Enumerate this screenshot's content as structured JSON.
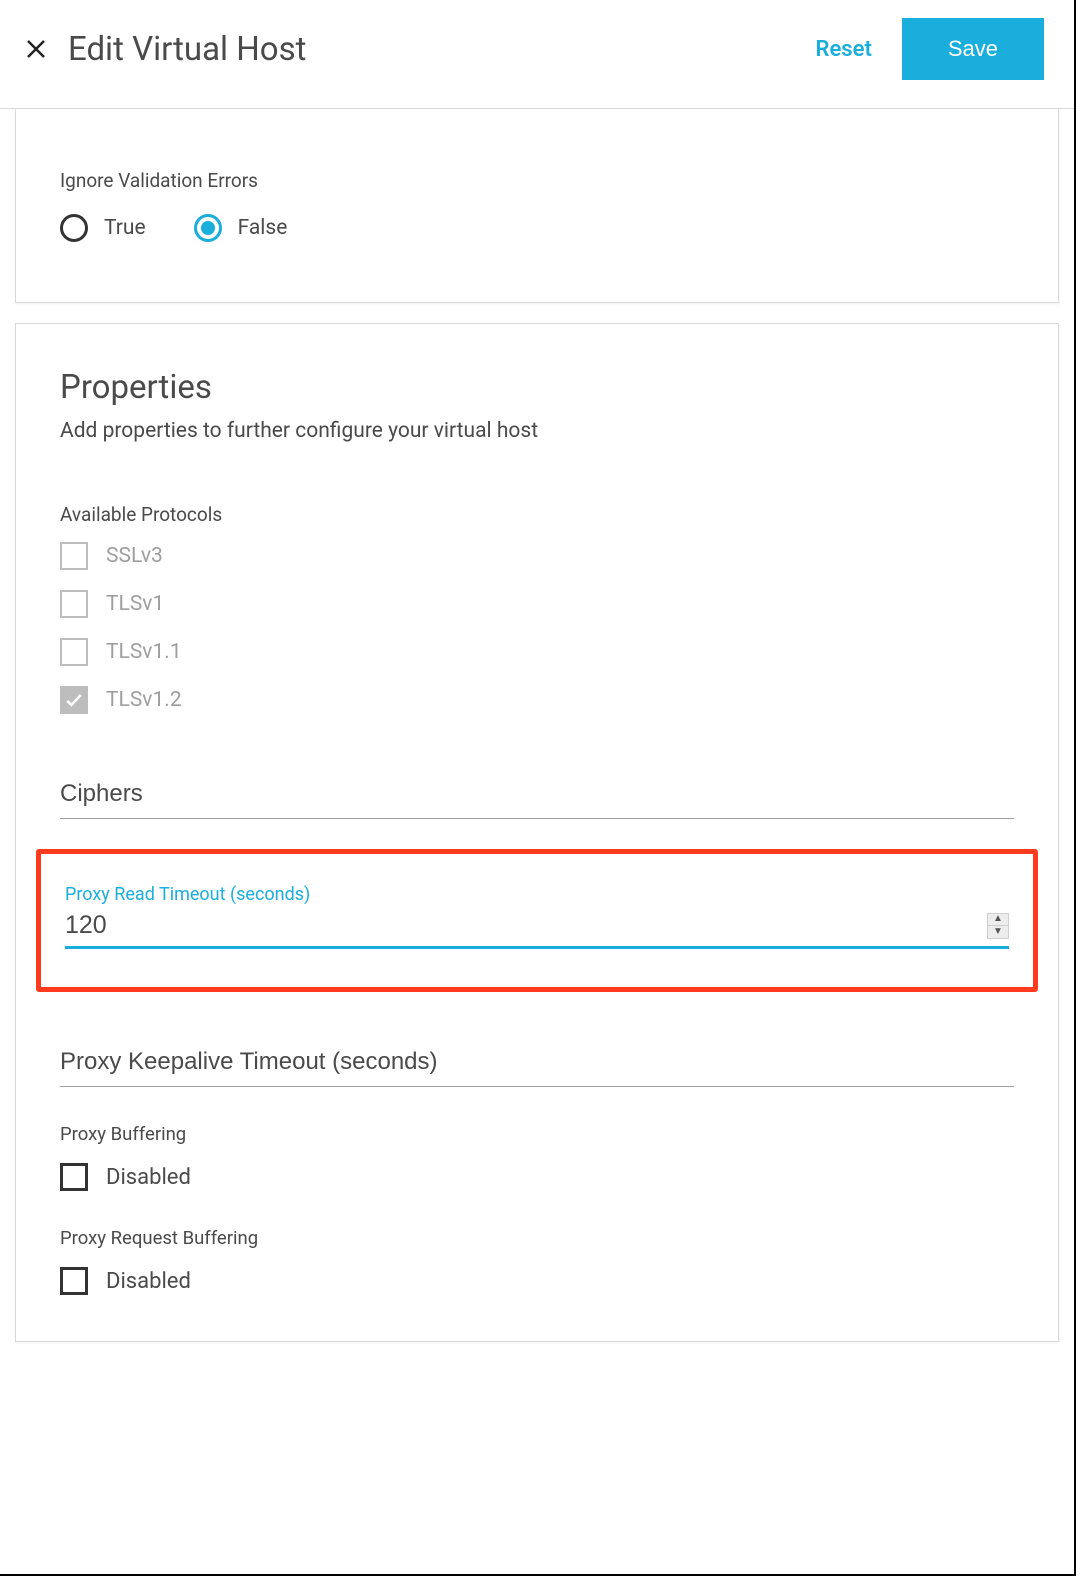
{
  "header": {
    "title": "Edit Virtual Host",
    "reset_label": "Reset",
    "save_label": "Save"
  },
  "validation": {
    "label": "Ignore Validation Errors",
    "options": {
      "true_label": "True",
      "false_label": "False"
    },
    "selected": "false"
  },
  "properties": {
    "heading": "Properties",
    "subheading": "Add properties to further configure your virtual host",
    "protocols_label": "Available Protocols",
    "protocols": [
      {
        "label": "SSLv3",
        "checked": false,
        "disabled": true
      },
      {
        "label": "TLSv1",
        "checked": false,
        "disabled": true
      },
      {
        "label": "TLSv1.1",
        "checked": false,
        "disabled": true
      },
      {
        "label": "TLSv1.2",
        "checked": true,
        "disabled": true
      }
    ],
    "ciphers_label": "Ciphers",
    "proxy_read_timeout": {
      "label": "Proxy Read Timeout (seconds)",
      "value": "120"
    },
    "proxy_keepalive_label": "Proxy Keepalive Timeout (seconds)",
    "proxy_buffering": {
      "label": "Proxy Buffering",
      "option_label": "Disabled",
      "checked": false
    },
    "proxy_request_buffering": {
      "label": "Proxy Request Buffering",
      "option_label": "Disabled",
      "checked": false
    }
  }
}
